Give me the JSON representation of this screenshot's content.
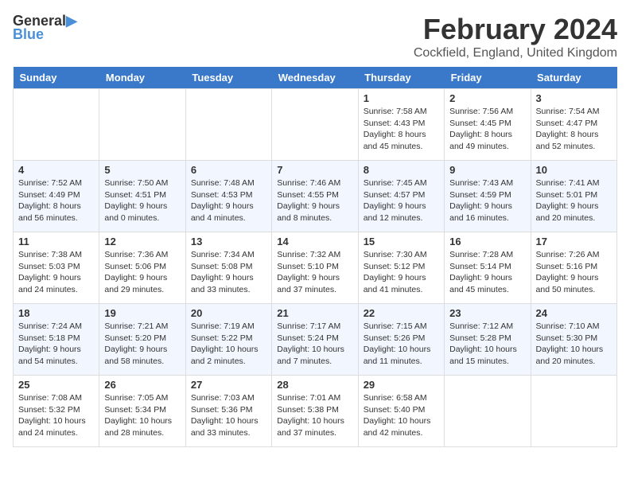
{
  "header": {
    "logo_line1": "General",
    "logo_line2": "Blue",
    "title": "February 2024",
    "subtitle": "Cockfield, England, United Kingdom"
  },
  "weekdays": [
    "Sunday",
    "Monday",
    "Tuesday",
    "Wednesday",
    "Thursday",
    "Friday",
    "Saturday"
  ],
  "weeks": [
    [
      {
        "day": "",
        "info": ""
      },
      {
        "day": "",
        "info": ""
      },
      {
        "day": "",
        "info": ""
      },
      {
        "day": "",
        "info": ""
      },
      {
        "day": "1",
        "info": "Sunrise: 7:58 AM\nSunset: 4:43 PM\nDaylight: 8 hours\nand 45 minutes."
      },
      {
        "day": "2",
        "info": "Sunrise: 7:56 AM\nSunset: 4:45 PM\nDaylight: 8 hours\nand 49 minutes."
      },
      {
        "day": "3",
        "info": "Sunrise: 7:54 AM\nSunset: 4:47 PM\nDaylight: 8 hours\nand 52 minutes."
      }
    ],
    [
      {
        "day": "4",
        "info": "Sunrise: 7:52 AM\nSunset: 4:49 PM\nDaylight: 8 hours\nand 56 minutes."
      },
      {
        "day": "5",
        "info": "Sunrise: 7:50 AM\nSunset: 4:51 PM\nDaylight: 9 hours\nand 0 minutes."
      },
      {
        "day": "6",
        "info": "Sunrise: 7:48 AM\nSunset: 4:53 PM\nDaylight: 9 hours\nand 4 minutes."
      },
      {
        "day": "7",
        "info": "Sunrise: 7:46 AM\nSunset: 4:55 PM\nDaylight: 9 hours\nand 8 minutes."
      },
      {
        "day": "8",
        "info": "Sunrise: 7:45 AM\nSunset: 4:57 PM\nDaylight: 9 hours\nand 12 minutes."
      },
      {
        "day": "9",
        "info": "Sunrise: 7:43 AM\nSunset: 4:59 PM\nDaylight: 9 hours\nand 16 minutes."
      },
      {
        "day": "10",
        "info": "Sunrise: 7:41 AM\nSunset: 5:01 PM\nDaylight: 9 hours\nand 20 minutes."
      }
    ],
    [
      {
        "day": "11",
        "info": "Sunrise: 7:38 AM\nSunset: 5:03 PM\nDaylight: 9 hours\nand 24 minutes."
      },
      {
        "day": "12",
        "info": "Sunrise: 7:36 AM\nSunset: 5:06 PM\nDaylight: 9 hours\nand 29 minutes."
      },
      {
        "day": "13",
        "info": "Sunrise: 7:34 AM\nSunset: 5:08 PM\nDaylight: 9 hours\nand 33 minutes."
      },
      {
        "day": "14",
        "info": "Sunrise: 7:32 AM\nSunset: 5:10 PM\nDaylight: 9 hours\nand 37 minutes."
      },
      {
        "day": "15",
        "info": "Sunrise: 7:30 AM\nSunset: 5:12 PM\nDaylight: 9 hours\nand 41 minutes."
      },
      {
        "day": "16",
        "info": "Sunrise: 7:28 AM\nSunset: 5:14 PM\nDaylight: 9 hours\nand 45 minutes."
      },
      {
        "day": "17",
        "info": "Sunrise: 7:26 AM\nSunset: 5:16 PM\nDaylight: 9 hours\nand 50 minutes."
      }
    ],
    [
      {
        "day": "18",
        "info": "Sunrise: 7:24 AM\nSunset: 5:18 PM\nDaylight: 9 hours\nand 54 minutes."
      },
      {
        "day": "19",
        "info": "Sunrise: 7:21 AM\nSunset: 5:20 PM\nDaylight: 9 hours\nand 58 minutes."
      },
      {
        "day": "20",
        "info": "Sunrise: 7:19 AM\nSunset: 5:22 PM\nDaylight: 10 hours\nand 2 minutes."
      },
      {
        "day": "21",
        "info": "Sunrise: 7:17 AM\nSunset: 5:24 PM\nDaylight: 10 hours\nand 7 minutes."
      },
      {
        "day": "22",
        "info": "Sunrise: 7:15 AM\nSunset: 5:26 PM\nDaylight: 10 hours\nand 11 minutes."
      },
      {
        "day": "23",
        "info": "Sunrise: 7:12 AM\nSunset: 5:28 PM\nDaylight: 10 hours\nand 15 minutes."
      },
      {
        "day": "24",
        "info": "Sunrise: 7:10 AM\nSunset: 5:30 PM\nDaylight: 10 hours\nand 20 minutes."
      }
    ],
    [
      {
        "day": "25",
        "info": "Sunrise: 7:08 AM\nSunset: 5:32 PM\nDaylight: 10 hours\nand 24 minutes."
      },
      {
        "day": "26",
        "info": "Sunrise: 7:05 AM\nSunset: 5:34 PM\nDaylight: 10 hours\nand 28 minutes."
      },
      {
        "day": "27",
        "info": "Sunrise: 7:03 AM\nSunset: 5:36 PM\nDaylight: 10 hours\nand 33 minutes."
      },
      {
        "day": "28",
        "info": "Sunrise: 7:01 AM\nSunset: 5:38 PM\nDaylight: 10 hours\nand 37 minutes."
      },
      {
        "day": "29",
        "info": "Sunrise: 6:58 AM\nSunset: 5:40 PM\nDaylight: 10 hours\nand 42 minutes."
      },
      {
        "day": "",
        "info": ""
      },
      {
        "day": "",
        "info": ""
      }
    ]
  ]
}
